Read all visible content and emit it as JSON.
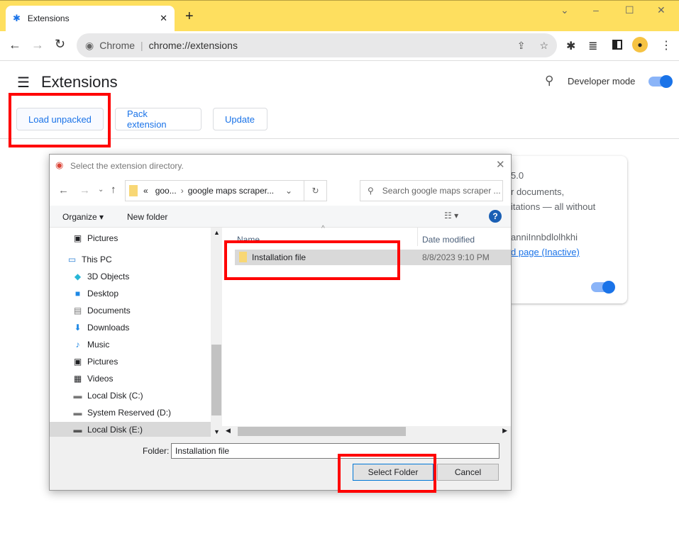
{
  "browser": {
    "tab_title": "Extensions",
    "omnibox_label": "Chrome",
    "url": "chrome://extensions"
  },
  "page": {
    "title": "Extensions",
    "developer_mode_label": "Developer mode",
    "developer_mode": true,
    "buttons": {
      "load_unpacked": "Load unpacked",
      "pack_extension": "Pack extension",
      "update": "Update"
    }
  },
  "card": {
    "version": "5.0",
    "desc1": "r documents,",
    "desc2": "itations — all without",
    "id": "anniInnbdlolhkhi",
    "link": "d page (Inactive)",
    "enabled": true
  },
  "dialog": {
    "title": "Select the extension directory.",
    "breadcrumb": {
      "prefix": "«",
      "crumb1": "goo...",
      "crumb2": "google maps scraper..."
    },
    "search_placeholder": "Search google maps scraper ...",
    "organize": "Organize",
    "new_folder": "New folder",
    "nav": [
      {
        "label": "Pictures",
        "icon": "pictures-icon"
      },
      {
        "label": "This PC",
        "icon": "pc-icon"
      },
      {
        "label": "3D Objects",
        "icon": "cube-icon"
      },
      {
        "label": "Desktop",
        "icon": "desktop-icon"
      },
      {
        "label": "Documents",
        "icon": "documents-icon"
      },
      {
        "label": "Downloads",
        "icon": "download-icon"
      },
      {
        "label": "Music",
        "icon": "music-icon"
      },
      {
        "label": "Pictures",
        "icon": "pictures-icon"
      },
      {
        "label": "Videos",
        "icon": "video-icon"
      },
      {
        "label": "Local Disk (C:)",
        "icon": "drive-icon"
      },
      {
        "label": "System Reserved (D:)",
        "icon": "drive-icon"
      },
      {
        "label": "Local Disk (E:)",
        "icon": "drive-icon"
      }
    ],
    "columns": {
      "name": "Name",
      "date": "Date modified"
    },
    "files": [
      {
        "name": "Installation file",
        "date": "8/8/2023 9:10 PM"
      }
    ],
    "folder_label": "Folder:",
    "folder_value": "Installation file",
    "select_button": "Select Folder",
    "cancel_button": "Cancel"
  },
  "colors": {
    "accent": "#1a73e8",
    "highlight": "#ff0000",
    "tabstrip": "#fedf5f"
  }
}
